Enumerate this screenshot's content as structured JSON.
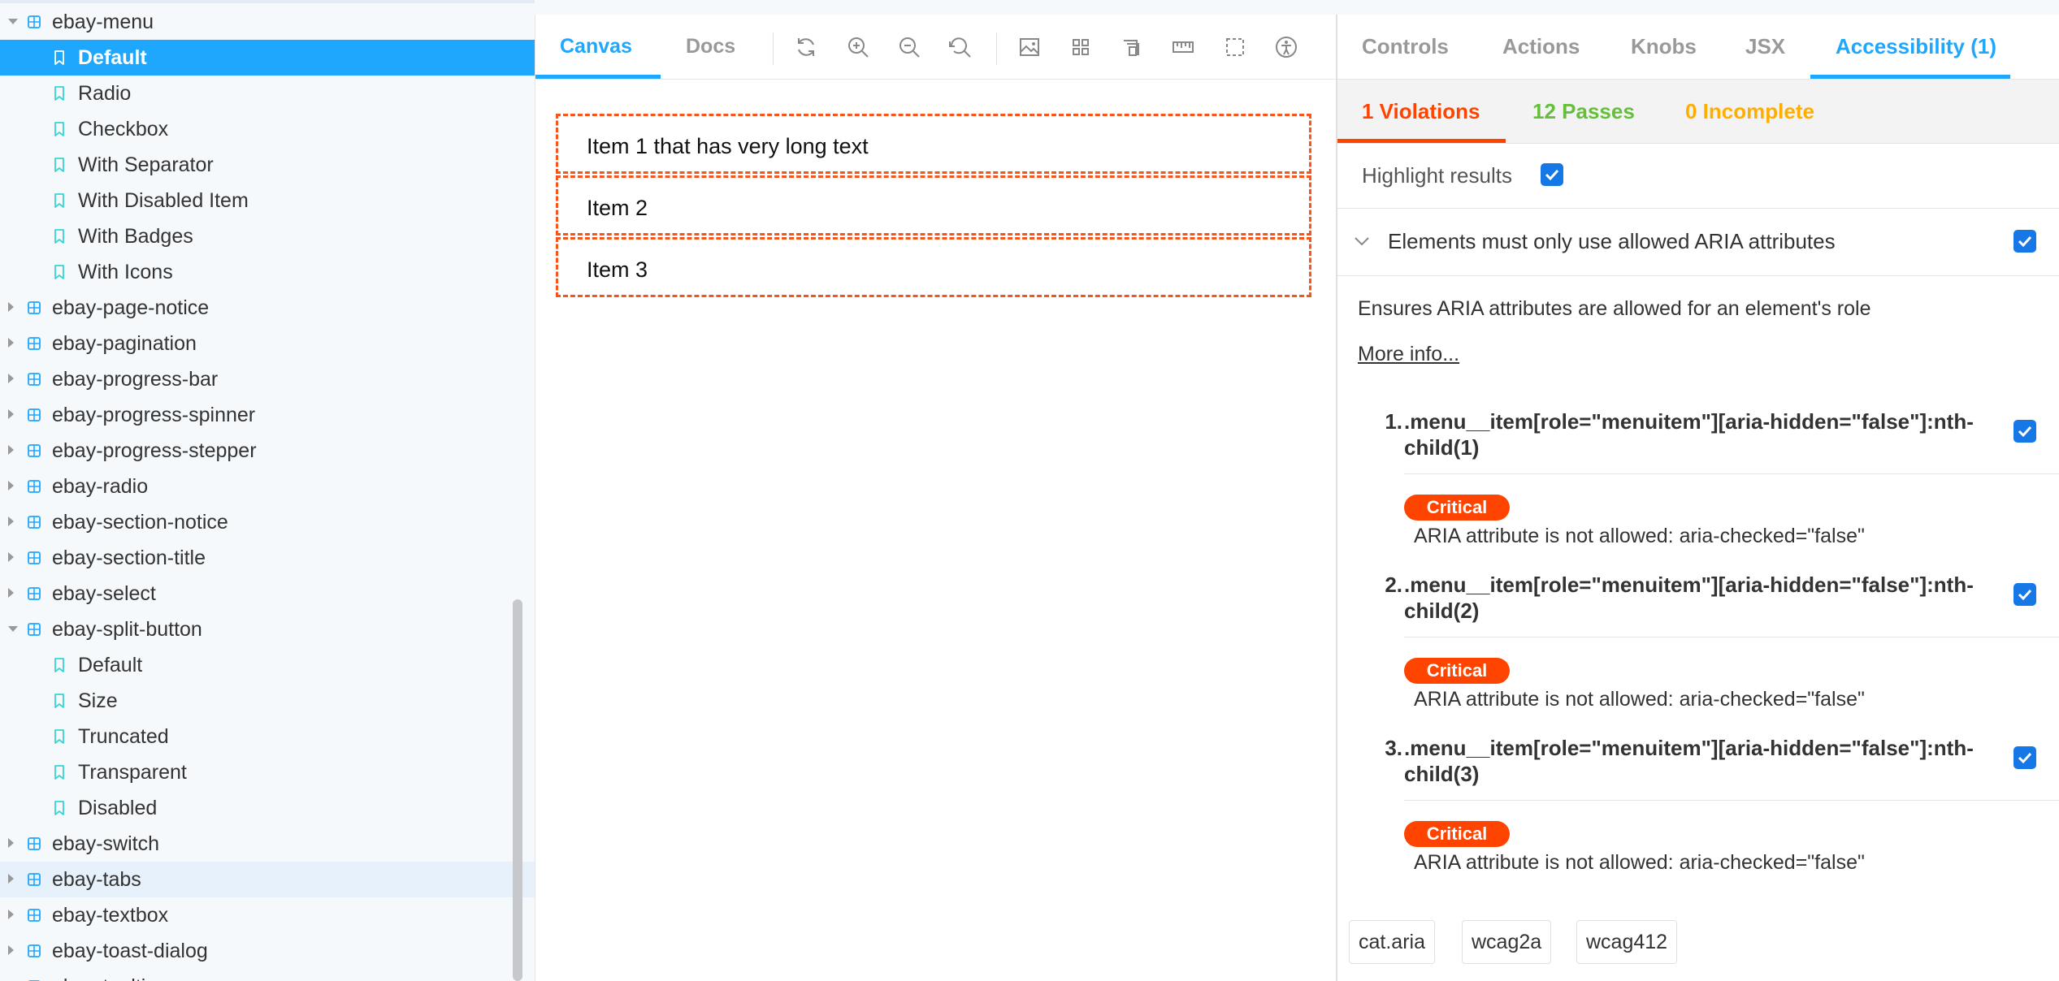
{
  "sidebar": {
    "items": [
      {
        "label": "ebay-menu",
        "kind": "component",
        "expanded": true
      },
      {
        "label": "Default",
        "kind": "story",
        "selected": true
      },
      {
        "label": "Radio",
        "kind": "story"
      },
      {
        "label": "Checkbox",
        "kind": "story"
      },
      {
        "label": "With Separator",
        "kind": "story"
      },
      {
        "label": "With Disabled Item",
        "kind": "story"
      },
      {
        "label": "With Badges",
        "kind": "story"
      },
      {
        "label": "With Icons",
        "kind": "story"
      },
      {
        "label": "ebay-page-notice",
        "kind": "component"
      },
      {
        "label": "ebay-pagination",
        "kind": "component"
      },
      {
        "label": "ebay-progress-bar",
        "kind": "component"
      },
      {
        "label": "ebay-progress-spinner",
        "kind": "component"
      },
      {
        "label": "ebay-progress-stepper",
        "kind": "component"
      },
      {
        "label": "ebay-radio",
        "kind": "component"
      },
      {
        "label": "ebay-section-notice",
        "kind": "component"
      },
      {
        "label": "ebay-section-title",
        "kind": "component"
      },
      {
        "label": "ebay-select",
        "kind": "component"
      },
      {
        "label": "ebay-split-button",
        "kind": "component",
        "expanded": true
      },
      {
        "label": "Default",
        "kind": "story"
      },
      {
        "label": "Size",
        "kind": "story"
      },
      {
        "label": "Truncated",
        "kind": "story"
      },
      {
        "label": "Transparent",
        "kind": "story"
      },
      {
        "label": "Disabled",
        "kind": "story"
      },
      {
        "label": "ebay-switch",
        "kind": "component"
      },
      {
        "label": "ebay-tabs",
        "kind": "component",
        "hovered": true
      },
      {
        "label": "ebay-textbox",
        "kind": "component"
      },
      {
        "label": "ebay-toast-dialog",
        "kind": "component"
      },
      {
        "label": "ebay-tooltip",
        "kind": "component"
      }
    ]
  },
  "preview": {
    "tabs": {
      "canvas": "Canvas",
      "docs": "Docs"
    },
    "toolbar_icons": [
      "reload-icon",
      "zoom-in-icon",
      "zoom-out-icon",
      "zoom-reset-icon",
      "background-icon",
      "grid-icon",
      "viewport-icon",
      "measure-icon",
      "outline-icon",
      "accessibility-icon"
    ],
    "menu_items": [
      "Item 1 that has very long text",
      "Item 2",
      "Item 3"
    ]
  },
  "addon": {
    "tabs": {
      "controls": "Controls",
      "actions": "Actions",
      "knobs": "Knobs",
      "jsx": "JSX",
      "accessibility": "Accessibility (1)"
    },
    "result_tabs": {
      "violations": "1 Violations",
      "passes": "12 Passes",
      "incomplete": "0 Incomplete"
    },
    "highlight_label": "Highlight results",
    "rule": {
      "title": "Elements must only use allowed ARIA attributes",
      "description": "Ensures ARIA attributes are allowed for an element's role",
      "more_info": "More info...",
      "nodes": [
        {
          "num": "1.",
          "selector": ".menu__item[role=\"menuitem\"][aria-hidden=\"false\"]:nth-child(1)",
          "impact": "Critical",
          "message": "ARIA attribute is not allowed: aria-checked=\"false\""
        },
        {
          "num": "2.",
          "selector": ".menu__item[role=\"menuitem\"][aria-hidden=\"false\"]:nth-child(2)",
          "impact": "Critical",
          "message": "ARIA attribute is not allowed: aria-checked=\"false\""
        },
        {
          "num": "3.",
          "selector": ".menu__item[role=\"menuitem\"][aria-hidden=\"false\"]:nth-child(3)",
          "impact": "Critical",
          "message": "ARIA attribute is not allowed: aria-checked=\"false\""
        }
      ],
      "tags": [
        "cat.aria",
        "wcag2a",
        "wcag412"
      ]
    }
  },
  "colors": {
    "accent": "#1ea7fd",
    "violation": "#ff4400",
    "pass": "#66bf3c",
    "incomplete": "#ffae00",
    "outline": "#f5541a"
  }
}
